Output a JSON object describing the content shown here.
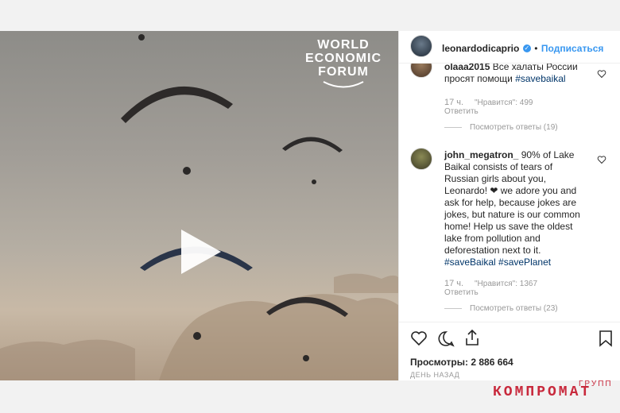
{
  "video": {
    "logo_lines": [
      "WORLD",
      "ECONOMIC",
      "FORUM"
    ]
  },
  "post": {
    "username": "leonardodicaprio",
    "separator": "•",
    "follow_label": "Подписаться"
  },
  "comments": [
    {
      "username": "olaaa2015",
      "text_prefix": "Все халаты России",
      "text_rest": "просят помощи",
      "hashtags": "#savebaikal",
      "time": "17 ч.",
      "likes": "\"Нравится\": 499",
      "reply": "Ответить",
      "view_replies": "Посмотреть ответы (19)"
    },
    {
      "username": "john_megatron_",
      "text": "90% of Lake Baikal consists of tears of Russian girls about you, Leonardo! ❤ we adore you and ask for help, because jokes are jokes, but nature is our common home! Help us save the oldest lake from pollution and deforestation next to it.",
      "hashtags": "#saveBaikal #savePlanet",
      "time": "17 ч.",
      "likes": "\"Нравится\": 1367",
      "reply": "Ответить",
      "view_replies": "Посмотреть ответы (23)"
    }
  ],
  "stats": {
    "views": "Просмотры: 2 886 664",
    "posted": "ДЕНЬ НАЗАД"
  },
  "watermark": {
    "top": "ГРУПП",
    "main": "КОМПРОМАТ"
  },
  "colors": {
    "link": "#3897f0",
    "hashtag": "#003569",
    "watermark": "#c8293c"
  },
  "icons": [
    "play-icon",
    "heart-icon",
    "comment-icon",
    "share-icon",
    "bookmark-icon",
    "verified-icon"
  ]
}
